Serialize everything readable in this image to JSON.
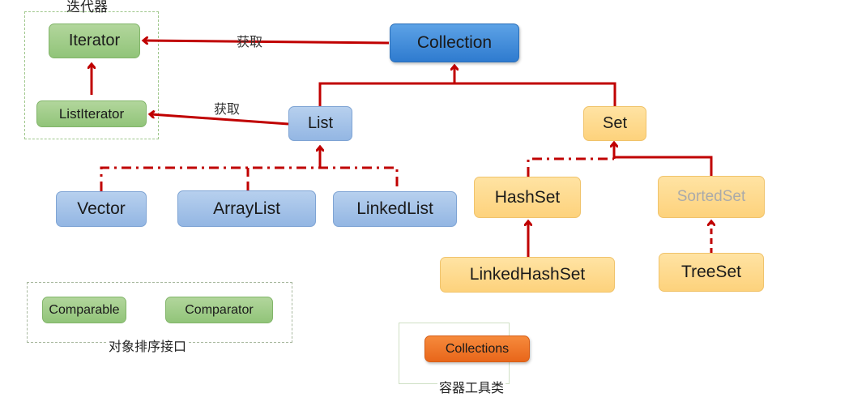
{
  "groups": {
    "iterator_group": {
      "caption": "迭代器"
    },
    "sort_group": {
      "caption": "对象排序接口"
    },
    "util_group": {
      "caption": "容器工具类"
    }
  },
  "nodes": {
    "iterator": {
      "label": "Iterator",
      "color": "#9fcd87"
    },
    "list_iterator": {
      "label": "ListIterator",
      "color": "#9fcd87"
    },
    "collection": {
      "label": "Collection",
      "color": "#3f8bd9"
    },
    "list": {
      "label": "List",
      "color": "#a8c6ec"
    },
    "set": {
      "label": "Set",
      "color": "#fedb8f"
    },
    "vector": {
      "label": "Vector",
      "color": "#a8c6ec"
    },
    "array_list": {
      "label": "ArrayList",
      "color": "#a8c6ec"
    },
    "linked_list": {
      "label": "LinkedList",
      "color": "#a8c6ec"
    },
    "hash_set": {
      "label": "HashSet",
      "color": "#fedb8f"
    },
    "sorted_set": {
      "label": "SortedSet",
      "color": "#fedb8f"
    },
    "linked_hash_set": {
      "label": "LinkedHashSet",
      "color": "#fedb8f"
    },
    "tree_set": {
      "label": "TreeSet",
      "color": "#fedb8f"
    },
    "comparable": {
      "label": "Comparable",
      "color": "#9fcd87"
    },
    "comparator": {
      "label": "Comparator",
      "color": "#9fcd87"
    },
    "collections": {
      "label": "Collections",
      "color": "#ee7427"
    }
  },
  "edges": [
    {
      "from": "Collection",
      "to": "Iterator",
      "label": "获取",
      "style": "solid"
    },
    {
      "from": "List",
      "to": "ListIterator",
      "label": "获取",
      "style": "solid"
    },
    {
      "from": "ListIterator",
      "to": "Iterator",
      "style": "solid"
    },
    {
      "from": "List",
      "to": "Collection",
      "style": "solid"
    },
    {
      "from": "Set",
      "to": "Collection",
      "style": "solid"
    },
    {
      "from": "Vector",
      "to": "List",
      "style": "dash-dot"
    },
    {
      "from": "ArrayList",
      "to": "List",
      "style": "dash-dot"
    },
    {
      "from": "LinkedList",
      "to": "List",
      "style": "dash-dot"
    },
    {
      "from": "HashSet",
      "to": "Set",
      "style": "dash-dot"
    },
    {
      "from": "SortedSet",
      "to": "Set",
      "style": "solid"
    },
    {
      "from": "LinkedHashSet",
      "to": "HashSet",
      "style": "solid"
    },
    {
      "from": "TreeSet",
      "to": "SortedSet",
      "style": "dashed"
    }
  ],
  "edge_labels": {
    "get_iterator": "获取",
    "get_list_iterator": "获取"
  },
  "colors": {
    "arrow": "#c00000",
    "group_border": "#9fc78c"
  }
}
